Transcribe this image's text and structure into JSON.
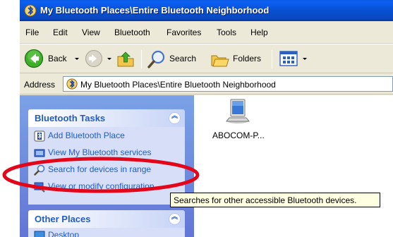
{
  "window": {
    "title": "My Bluetooth Places\\Entire Bluetooth Neighborhood"
  },
  "menu": {
    "items": [
      "File",
      "Edit",
      "View",
      "Bluetooth",
      "Favorites",
      "Tools",
      "Help"
    ]
  },
  "toolbar": {
    "back_label": "Back",
    "search_label": "Search",
    "folders_label": "Folders"
  },
  "address": {
    "label": "Address",
    "value": "My Bluetooth Places\\Entire Bluetooth Neighborhood"
  },
  "tasks": {
    "title": "Bluetooth Tasks",
    "items": [
      {
        "label": "Add Bluetooth Place",
        "icon": "bluetooth-place-icon"
      },
      {
        "label": "View My Bluetooth services",
        "icon": "services-icon"
      },
      {
        "label": "Search for devices in range",
        "icon": "search-magnifier-icon"
      },
      {
        "label": "View or modify configuration",
        "icon": "configuration-icon"
      }
    ]
  },
  "other_places": {
    "title": "Other Places",
    "items": [
      {
        "label": "Desktop",
        "icon": "desktop-icon"
      }
    ]
  },
  "devices": [
    {
      "label": "ABOCOM-P...",
      "icon": "computer-device-icon"
    }
  ],
  "tooltip": {
    "text": "Searches for other accessible Bluetooth devices."
  },
  "colors": {
    "title_bar": "#0a5ae6",
    "task_link": "#215dc6",
    "task_pane": "#6f8fe0",
    "annotation_ellipse": "#e3061b",
    "tooltip_bg": "#ffffe1"
  }
}
